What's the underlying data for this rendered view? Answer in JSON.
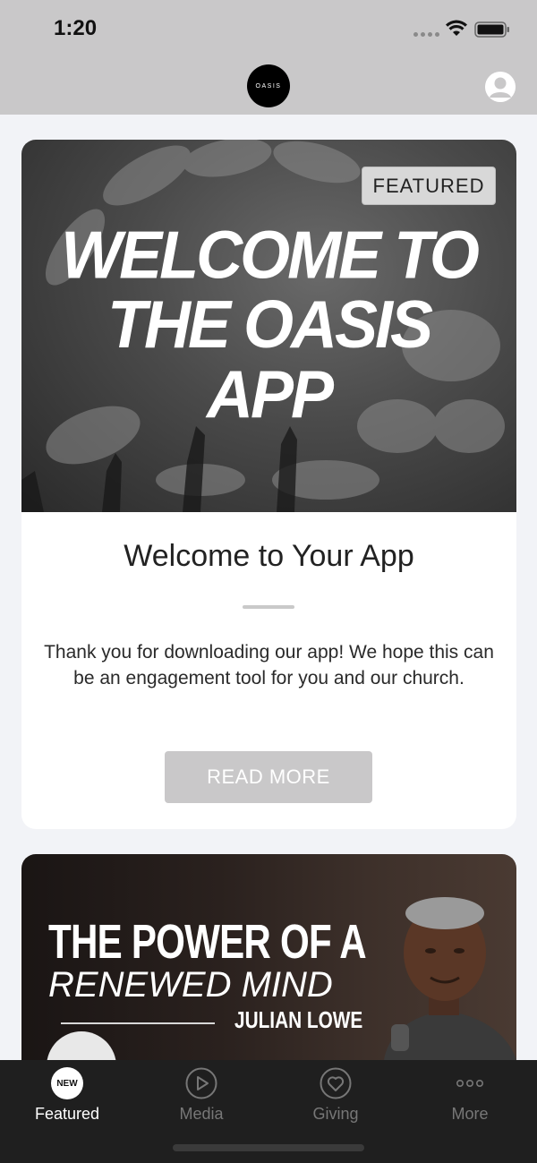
{
  "status_bar": {
    "time": "1:20"
  },
  "nav": {
    "logo_text": "OASIS"
  },
  "featured_card": {
    "badge": "FEATURED",
    "hero_lines": [
      "WELCOME TO",
      "THE OASIS",
      "APP"
    ],
    "heading": "Welcome to Your App",
    "body": "Thank you for downloading our app! We hope this can be an engagement tool for you and our church.",
    "button_label": "READ MORE"
  },
  "sermon_card": {
    "title": "THE POWER OF A",
    "subtitle": "RENEWED MIND",
    "speaker": "JULIAN LOWE"
  },
  "tab_bar": {
    "tabs": [
      {
        "label": "Featured",
        "badge": "NEW",
        "icon": "new-badge-icon",
        "active": true
      },
      {
        "label": "Media",
        "icon": "play-icon",
        "active": false
      },
      {
        "label": "Giving",
        "icon": "heart-icon",
        "active": false
      },
      {
        "label": "More",
        "icon": "more-icon",
        "active": false
      }
    ]
  },
  "colors": {
    "header_bg": "#c9c8c9",
    "page_bg": "#f2f3f7",
    "tab_bar_bg": "#1f1f1f",
    "button_bg": "#c9c8c9"
  }
}
